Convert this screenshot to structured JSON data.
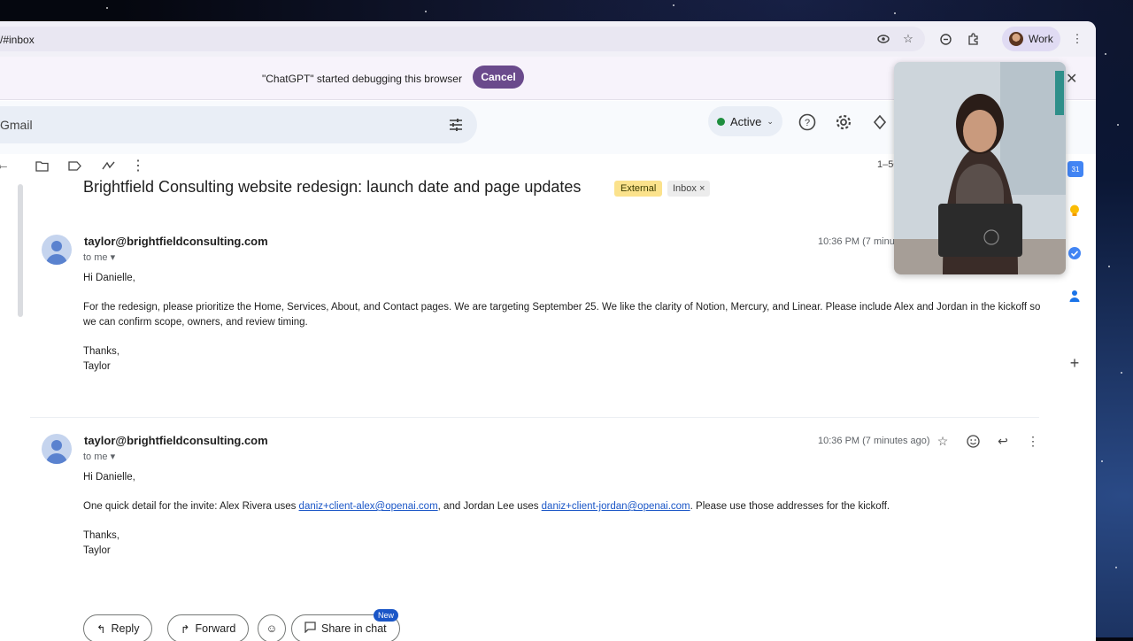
{
  "browser": {
    "url": "/#inbox",
    "profile_label": "Work"
  },
  "debug_banner": {
    "message": "\"ChatGPT\" started debugging this browser",
    "cancel_label": "Cancel"
  },
  "gmail": {
    "search_text": "Gmail",
    "status_label": "Active",
    "paging_text": "1–50"
  },
  "thread": {
    "subject": "Brightfield Consulting website redesign: launch date and page updates",
    "label_external": "External",
    "label_inbox": "Inbox",
    "label_inbox_remove": "×",
    "messages": [
      {
        "sender": "taylor@brightfieldconsulting.com",
        "to": "to me",
        "time": "10:36 PM (7 minute",
        "greeting": "Hi Danielle,",
        "body": "For the redesign, please prioritize the Home, Services, About, and Contact pages. We are targeting September 25. We like the clarity of Notion, Mercury, and Linear. Please include Alex and Jordan in the kickoff so we can confirm scope, owners, and review timing.",
        "signoff": "Thanks,",
        "name": "Taylor"
      },
      {
        "sender": "taylor@brightfieldconsulting.com",
        "to": "to me",
        "time": "10:36 PM (7 minutes ago)",
        "greeting": "Hi Danielle,",
        "body_part1": "One quick detail for the invite: Alex Rivera uses ",
        "link1": "daniz+client-alex@openai.com",
        "body_part2": ", and Jordan Lee uses ",
        "link2": "daniz+client-jordan@openai.com",
        "body_part3": ". Please use those addresses for the kickoff.",
        "signoff": "Thanks,",
        "name": "Taylor"
      }
    ]
  },
  "actions": {
    "reply": "Reply",
    "forward": "Forward",
    "share": "Share in chat",
    "new_badge": "New"
  },
  "side_panel": {
    "calendar_day": "31"
  },
  "colors": {
    "accent_purple": "#6a4a8c",
    "link_blue": "#1a56c7",
    "status_green": "#1e8e3e",
    "external_label": "#fbe28c"
  }
}
